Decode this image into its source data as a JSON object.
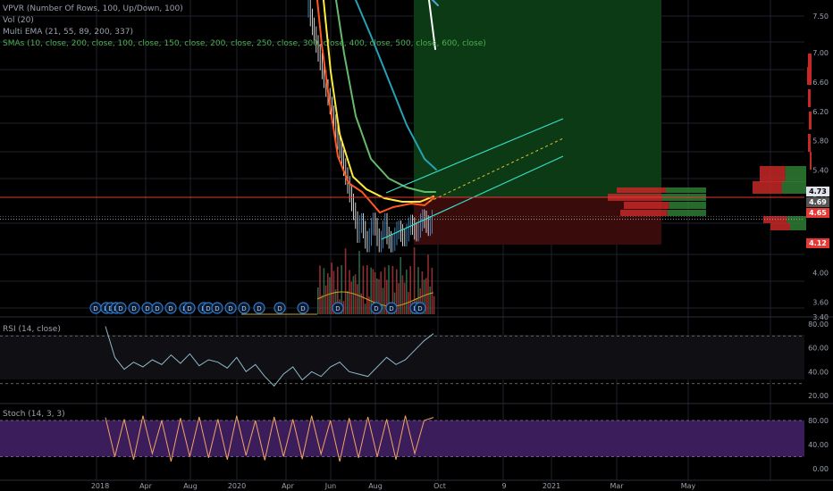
{
  "legend": {
    "vpvr": "VPVR (Number Of Rows, 100, Up/Down, 100)",
    "vol": "Vol (20)",
    "ema": "Multi EMA (21, 55, 89, 200, 337)",
    "smas": "SMAs (10, close, 200, close, 100, close, 150, close, 200, close, 250, close, 300, close, 400, close, 500, close, 600, close)"
  },
  "panes": {
    "rsi_label": "RSI (14, close)",
    "stoch_label": "Stoch (14, 3, 3)"
  },
  "colors": {
    "background": "#000000",
    "grid": "#1e222d",
    "up": "#26a69a",
    "down": "#ef5350",
    "ema21": "#ff5722",
    "ema55": "#ffeb3b",
    "ema89": "#66bb6a",
    "ema200": "#26a1b5",
    "rsi": "#8fb9c9",
    "stoch": "#f4a460",
    "stoch_band": "#3c1d5c",
    "profit_zone": "#0c3a14",
    "loss_zone": "#3a0b0b",
    "channel": "#35e0c8"
  },
  "price_tags": [
    {
      "text": "4.73",
      "bg": "#e0e3eb",
      "fg": "#000000"
    },
    {
      "text": "4.69",
      "bg": "#555555",
      "fg": "#ffffff"
    },
    {
      "text": "4.65",
      "bg": "#e53935",
      "fg": "#ffffff"
    },
    {
      "text": "4.12",
      "bg": "#e53935",
      "fg": "#ffffff"
    }
  ],
  "chart_data": {
    "type": "line",
    "title": "",
    "x_axis_labels": [
      "2018",
      "Apr",
      "Aug",
      "2020",
      "Apr",
      "Jun",
      "Aug",
      "Oct",
      "9",
      "2021",
      "Mar",
      "May"
    ],
    "price_axis": {
      "ticks": [
        7.5,
        7.0,
        6.6,
        6.2,
        5.8,
        5.4,
        5.0,
        4.4,
        4.0,
        3.6,
        3.4
      ],
      "range": [
        3.3,
        7.8
      ]
    },
    "price_levels": {
      "last": 4.73,
      "entry": 4.69,
      "stop_label": 4.65,
      "stop_loss": 4.12
    },
    "rsi": {
      "ticks": [
        80,
        60,
        40,
        20
      ],
      "upper_band": 70,
      "lower_band": 30,
      "values": [
        78,
        52,
        42,
        48,
        44,
        50,
        46,
        54,
        47,
        55,
        45,
        50,
        48,
        43,
        52,
        40,
        46,
        36,
        28,
        38,
        44,
        33,
        40,
        36,
        44,
        48,
        40,
        38,
        36,
        44,
        52,
        46,
        50,
        58,
        66,
        72
      ]
    },
    "stoch": {
      "ticks": [
        80,
        40,
        0
      ],
      "upper_band": 80,
      "lower_band": 20,
      "values": [
        85,
        20,
        82,
        15,
        88,
        25,
        80,
        12,
        84,
        20,
        86,
        18,
        82,
        15,
        88,
        22,
        80,
        14,
        86,
        20,
        82,
        16,
        88,
        24,
        80,
        12,
        84,
        18,
        86,
        20,
        82,
        15,
        88,
        25,
        80,
        85
      ]
    },
    "dividend_markers": 24
  }
}
